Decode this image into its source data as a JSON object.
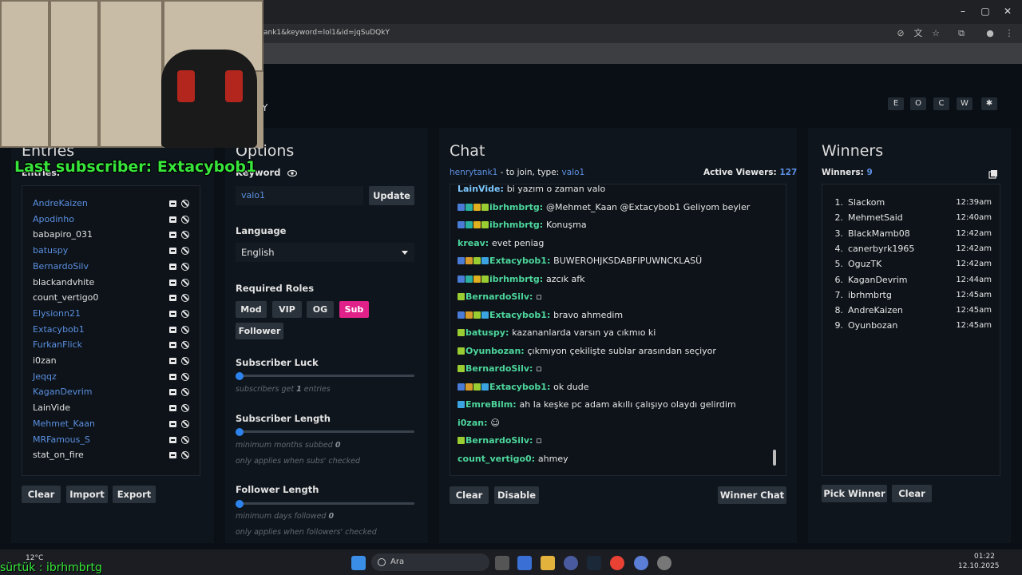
{
  "browser": {
    "url": "ank1&keyword=lol1&id=jqSuDQkY"
  },
  "header": {
    "title_fragment": "Y",
    "buttons": [
      "E",
      "O",
      "C",
      "W",
      "✱"
    ]
  },
  "overlay": {
    "last_subscriber": "Last subscriber: Extacybob1",
    "ticker": "sürtük : ibrhmbrtg"
  },
  "entries": {
    "title": "Entries",
    "label": "Entries:",
    "items": [
      {
        "name": "AndreKaizen",
        "color": "blue"
      },
      {
        "name": "Apodinho",
        "color": "blue"
      },
      {
        "name": "babapiro_031",
        "color": "white"
      },
      {
        "name": "batuspy",
        "color": "blue"
      },
      {
        "name": "BernardoSilv",
        "color": "blue"
      },
      {
        "name": "blackandvhite",
        "color": "white"
      },
      {
        "name": "count_vertigo0",
        "color": "white"
      },
      {
        "name": "Elysionn21",
        "color": "blue"
      },
      {
        "name": "Extacybob1",
        "color": "blue"
      },
      {
        "name": "FurkanFlick",
        "color": "blue"
      },
      {
        "name": "i0zan",
        "color": "white"
      },
      {
        "name": "Jeqqz",
        "color": "blue"
      },
      {
        "name": "KaganDevrim",
        "color": "blue"
      },
      {
        "name": "LainVide",
        "color": "white"
      },
      {
        "name": "Mehmet_Kaan",
        "color": "blue"
      },
      {
        "name": "MRFamous_S",
        "color": "blue"
      },
      {
        "name": "stat_on_fire",
        "color": "white"
      }
    ],
    "buttons": {
      "clear": "Clear",
      "import": "Import",
      "export": "Export"
    }
  },
  "options": {
    "title": "Options",
    "keyword_label": "Keyword",
    "keyword_value": "valo1",
    "update_button": "Update",
    "language_label": "Language",
    "language_value": "English",
    "roles_label": "Required Roles",
    "roles": [
      {
        "label": "Mod",
        "active": false
      },
      {
        "label": "VIP",
        "active": false
      },
      {
        "label": "OG",
        "active": false
      },
      {
        "label": "Sub",
        "active": true
      },
      {
        "label": "Follower",
        "active": false
      }
    ],
    "sub_luck": {
      "label": "Subscriber Luck",
      "value": 1,
      "hint_pre": "subscribers get ",
      "hint_val": "1",
      "hint_post": " entries"
    },
    "sub_length": {
      "label": "Subscriber Length",
      "value": 0,
      "hint_pre": "minimum months subbed ",
      "hint_val": "0",
      "hint2": "only applies when subs' checked"
    },
    "follower_length": {
      "label": "Follower Length",
      "value": 0,
      "hint_pre": "minimum days followed ",
      "hint_val": "0",
      "hint2": "only applies when followers' checked"
    }
  },
  "chat": {
    "title": "Chat",
    "channel": "henrytank1",
    "join_text": " - to join, type: ",
    "join_keyword": "valo1",
    "viewers_label": "Active Viewers:",
    "viewers_count": "127",
    "messages": [
      {
        "user": "LainVide",
        "msg": "bi yazım o zaman valo",
        "color": "#7ec8ff",
        "badges": []
      },
      {
        "user": "ibrhmbrtg",
        "msg": "@Mehmet_Kaan @Extacybob1 Geliyom beyler",
        "color": "#4dd69c",
        "badges": [
          "#4a7bd6",
          "#2bb0a0",
          "#e0b020",
          "#9acd32"
        ]
      },
      {
        "user": "ibrhmbrtg",
        "msg": "Konuşma",
        "color": "#4dd69c",
        "badges": [
          "#4a7bd6",
          "#2bb0a0",
          "#e0b020",
          "#9acd32"
        ]
      },
      {
        "user": "kreav",
        "msg": "evet peniag",
        "color": "#4dd69c",
        "badges": []
      },
      {
        "user": "Extacybob1",
        "msg": "BUWEROHJKSDABFIPUWNCKLASÜ",
        "color": "#4dd69c",
        "badges": [
          "#4a7bd6",
          "#d69b2b",
          "#9acd32",
          "#3ba3e0"
        ]
      },
      {
        "user": "ibrhmbrtg",
        "msg": "azcık afk",
        "color": "#4dd69c",
        "badges": [
          "#4a7bd6",
          "#2bb0a0",
          "#e0b020",
          "#9acd32"
        ]
      },
      {
        "user": "BernardoSilv",
        "msg": "▫",
        "color": "#4dd69c",
        "badges": [
          "#9acd32"
        ]
      },
      {
        "user": "Extacybob1",
        "msg": "bravo ahmedim",
        "color": "#4dd69c",
        "badges": [
          "#4a7bd6",
          "#d69b2b",
          "#9acd32",
          "#3ba3e0"
        ]
      },
      {
        "user": "batuspy",
        "msg": "kazananlarda varsın ya cıkmıo ki",
        "color": "#4dd69c",
        "badges": [
          "#9acd32"
        ]
      },
      {
        "user": "Oyunbozan",
        "msg": "çıkmıyon çekilişte sublar arasından seçiyor",
        "color": "#4dd69c",
        "badges": [
          "#9acd32"
        ]
      },
      {
        "user": "BernardoSilv",
        "msg": "▫",
        "color": "#4dd69c",
        "badges": [
          "#9acd32"
        ]
      },
      {
        "user": "Extacybob1",
        "msg": "ok dude",
        "color": "#4dd69c",
        "badges": [
          "#4a7bd6",
          "#d69b2b",
          "#9acd32",
          "#3ba3e0"
        ]
      },
      {
        "user": "EmreBilm",
        "msg": "ah la keşke pc adam akıllı çalışıyo olaydı gelirdim",
        "color": "#4dd69c",
        "badges": [
          "#3ba3e0"
        ]
      },
      {
        "user": "i0zan",
        "msg": "☺",
        "color": "#4dd69c",
        "badges": []
      },
      {
        "user": "BernardoSilv",
        "msg": "▫",
        "color": "#4dd69c",
        "badges": [
          "#9acd32"
        ]
      },
      {
        "user": "count_vertigo0",
        "msg": "ahmey",
        "color": "#4dd69c",
        "badges": []
      }
    ],
    "buttons": {
      "clear": "Clear",
      "disable": "Disable",
      "winner_chat": "Winner Chat"
    }
  },
  "winners": {
    "title": "Winners",
    "label": "Winners:",
    "count": "9",
    "items": [
      {
        "num": "1.",
        "name": "Slackom",
        "time": "12:39am"
      },
      {
        "num": "2.",
        "name": "MehmetSaid",
        "time": "12:40am"
      },
      {
        "num": "3.",
        "name": "BlackMamb08",
        "time": "12:42am"
      },
      {
        "num": "4.",
        "name": "canerbyrk1965",
        "time": "12:42am"
      },
      {
        "num": "5.",
        "name": "OguzTK",
        "time": "12:42am"
      },
      {
        "num": "6.",
        "name": "KaganDevrim",
        "time": "12:44am"
      },
      {
        "num": "7.",
        "name": "ibrhmbrtg",
        "time": "12:45am"
      },
      {
        "num": "8.",
        "name": "AndreKaizen",
        "time": "12:45am"
      },
      {
        "num": "9.",
        "name": "Oyunbozan",
        "time": "12:45am"
      }
    ],
    "buttons": {
      "pick": "Pick Winner",
      "clear": "Clear"
    }
  },
  "taskbar": {
    "search_placeholder": "Ara",
    "weather": "12°C",
    "time": "01:22",
    "date": "12.10.2025"
  },
  "colors": {
    "accent": "#2d83ee",
    "sub_active": "#e0218a",
    "link_blue": "#5b8fe0",
    "chat_green": "#4dd69c"
  }
}
